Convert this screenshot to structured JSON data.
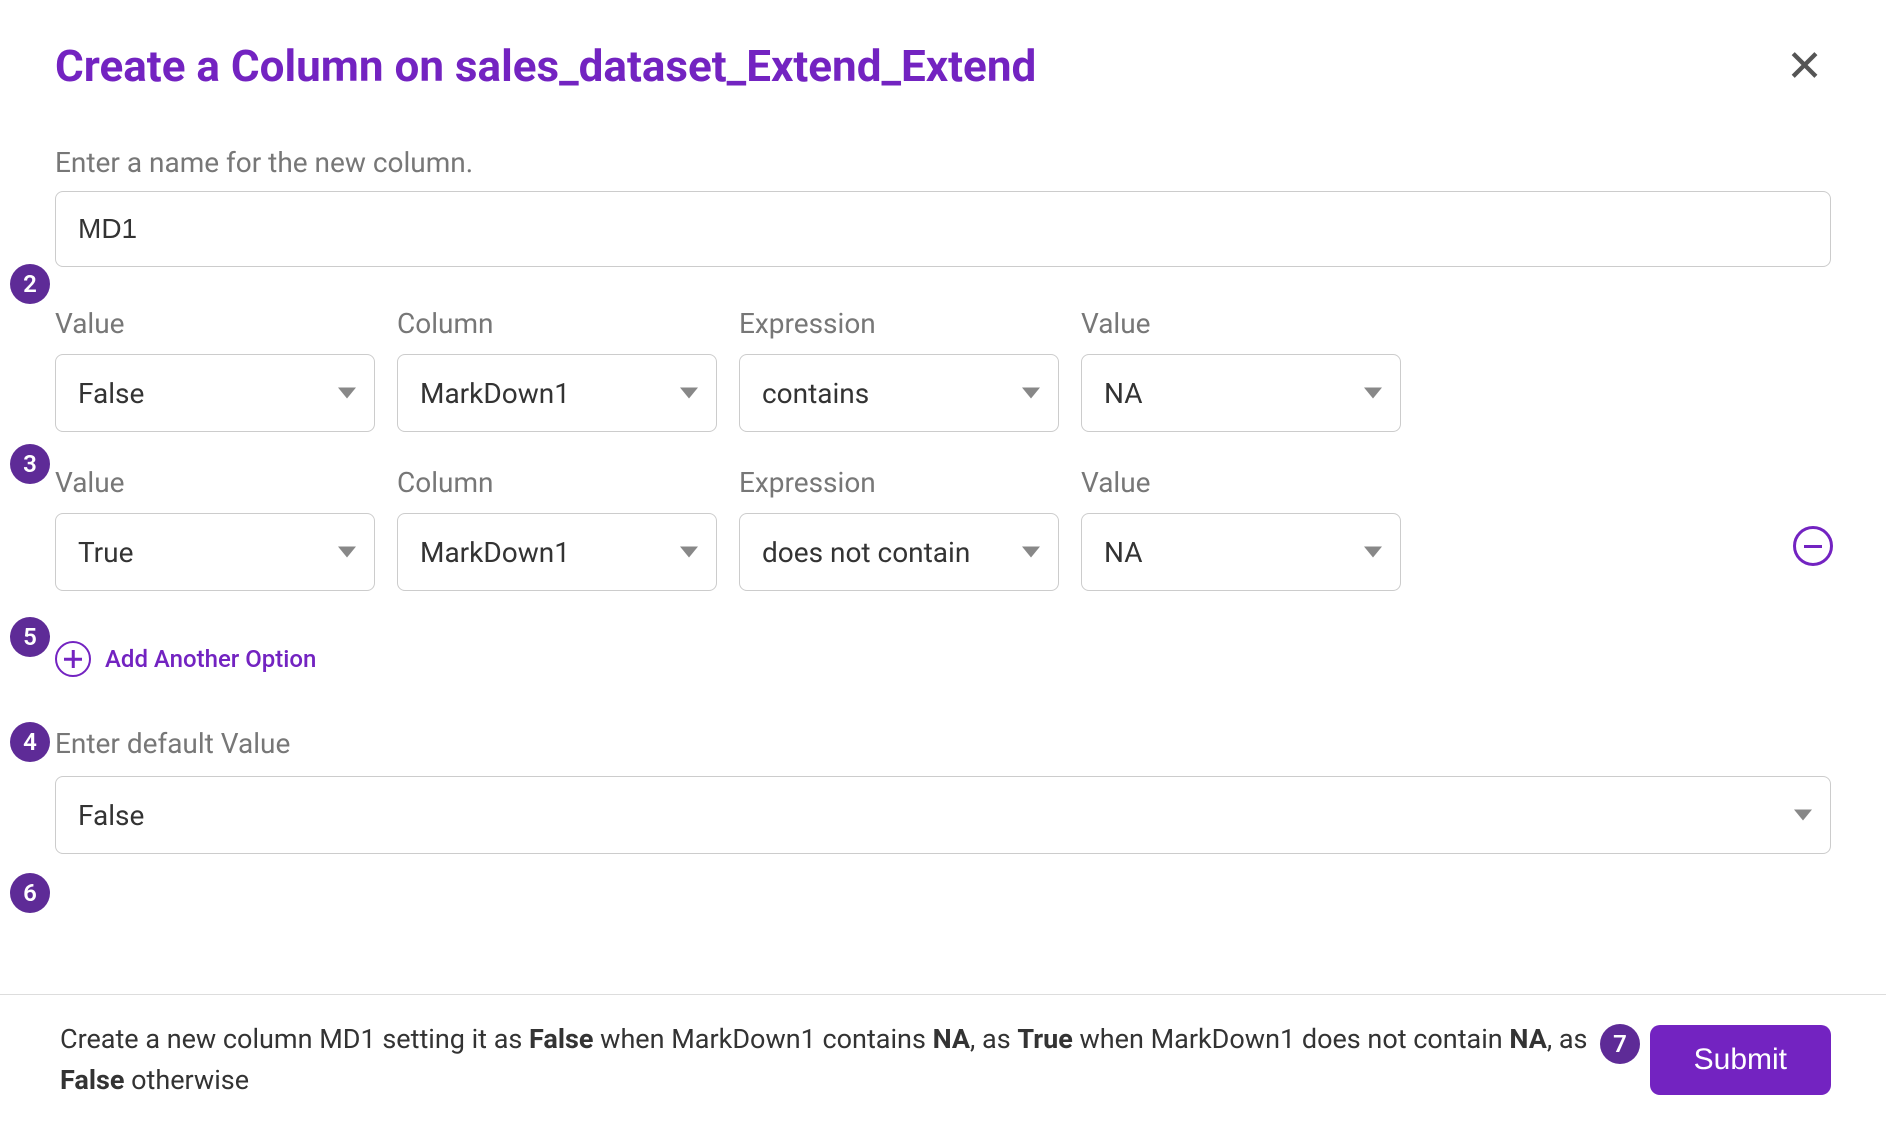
{
  "header": {
    "title": "Create a Column on sales_dataset_Extend_Extend"
  },
  "nameSection": {
    "label": "Enter a name for the new column.",
    "value": "MD1"
  },
  "fieldLabels": {
    "value": "Value",
    "column": "Column",
    "expression": "Expression",
    "value2": "Value"
  },
  "rows": [
    {
      "value": "False",
      "column": "MarkDown1",
      "expression": "contains",
      "match": "NA",
      "removable": false
    },
    {
      "value": "True",
      "column": "MarkDown1",
      "expression": "does not contain",
      "match": "NA",
      "removable": true
    }
  ],
  "addOption": {
    "label": "Add Another Option"
  },
  "defaultSection": {
    "label": "Enter default Value",
    "value": "False"
  },
  "footer": {
    "summaryHtml": "Create a new column MD1 setting it as <b>False</b> when MarkDown1 contains <b>NA</b>, as <b>True</b> when MarkDown1 does not contain <b>NA</b>, as <b>False</b> otherwise",
    "submit": "Submit"
  },
  "badges": {
    "b2": "2",
    "b3": "3",
    "b4": "4",
    "b5": "5",
    "b6": "6",
    "b7": "7"
  }
}
